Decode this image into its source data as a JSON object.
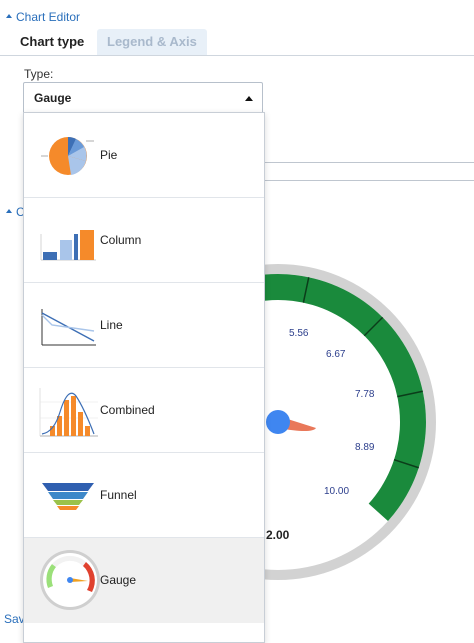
{
  "editor": {
    "section_title": "Chart Editor",
    "tabs": [
      {
        "label": "Chart type",
        "active": true
      },
      {
        "label": "Legend & Axis",
        "active": false
      }
    ],
    "type_label": "Type:",
    "type_select": {
      "selected": "Gauge"
    },
    "type_options": [
      {
        "label": "Pie",
        "icon": "pie-chart-icon"
      },
      {
        "label": "Column",
        "icon": "column-chart-icon"
      },
      {
        "label": "Line",
        "icon": "line-chart-icon"
      },
      {
        "label": "Combined",
        "icon": "combined-chart-icon"
      },
      {
        "label": "Funnel",
        "icon": "funnel-chart-icon"
      },
      {
        "label": "Gauge",
        "icon": "gauge-chart-icon"
      }
    ],
    "collapsed_section_letter": "C",
    "save_fragment": "Sav"
  },
  "gauge_preview": {
    "tick_labels": [
      "5.56",
      "6.67",
      "7.78",
      "8.89",
      "10.00"
    ],
    "value_label": "2.00",
    "colors": {
      "band": "#1a8a3c",
      "rim": "#cfcfcf",
      "needle": "#e9785a",
      "hub": "#3f86f0",
      "tick_text": "#2c3e8c"
    }
  },
  "colors": {
    "accent": "#2a6fbb",
    "tab_inactive_bg": "#e8f0f8",
    "selected_option_bg": "#f0f0f0"
  }
}
